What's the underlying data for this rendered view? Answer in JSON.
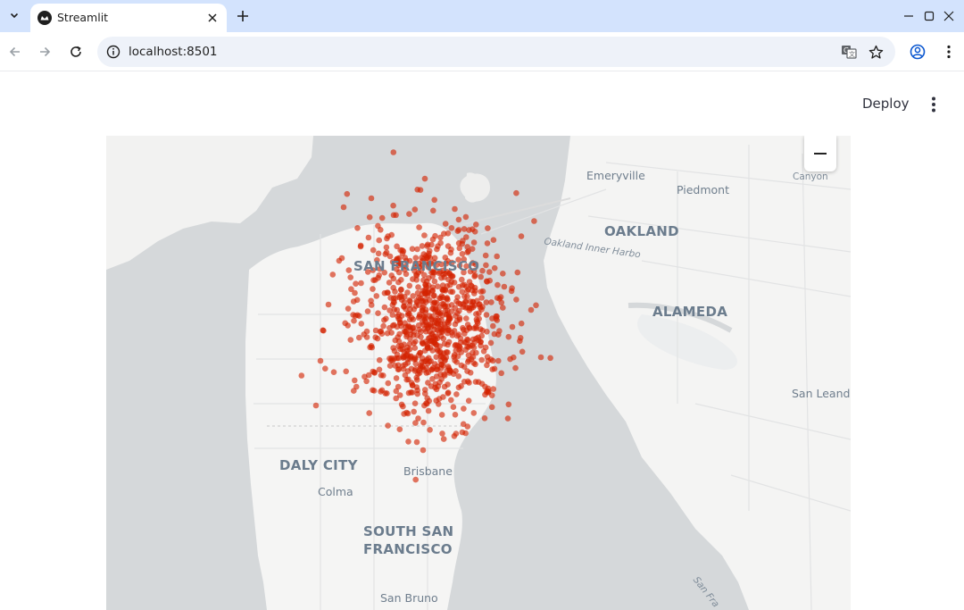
{
  "browser": {
    "tab_title": "Streamlit",
    "url": "localhost:8501"
  },
  "app": {
    "deploy_label": "Deploy"
  },
  "map": {
    "zoom_out_label": "−",
    "point_color": "#d42200",
    "water_color": "#d5d8da",
    "land_color": "#f5f5f4",
    "labels": {
      "emeryville": "Emeryville",
      "piedmont": "Piedmont",
      "canyon": "Canyon",
      "oakland": "OAKLAND",
      "oakland_harbor": "Oakland Inner Harbo",
      "san_francisco": "SAN FRANCISCO",
      "alameda": "ALAMEDA",
      "san_leandro": "San Leand",
      "daly_city": "DALY CITY",
      "brisbane": "Brisbane",
      "colma": "Colma",
      "south_sf_1": "SOUTH SAN",
      "south_sf_2": "FRANCISCO",
      "san_bruno": "San Bruno",
      "san_fra_road": "San Fra"
    }
  }
}
